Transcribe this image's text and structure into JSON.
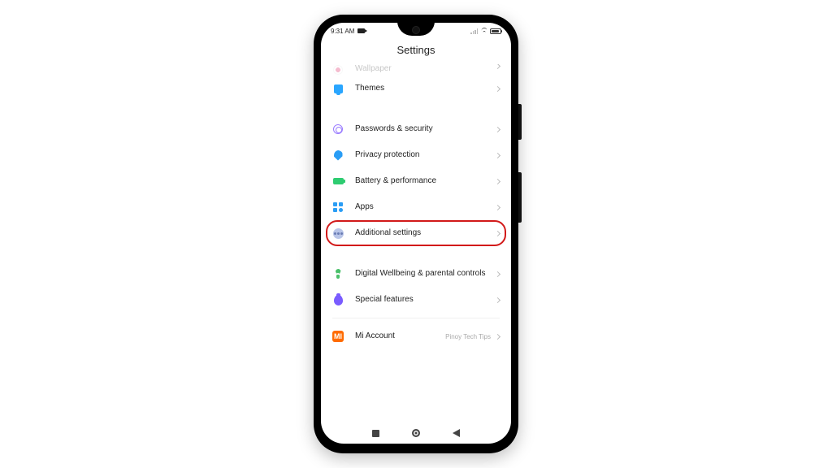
{
  "status": {
    "time": "9:31 AM"
  },
  "header": {
    "title": "Settings"
  },
  "rows": {
    "wallpaper": {
      "label": "Wallpaper"
    },
    "themes": {
      "label": "Themes"
    },
    "passwords": {
      "label": "Passwords & security"
    },
    "privacy": {
      "label": "Privacy protection"
    },
    "battery": {
      "label": "Battery & performance"
    },
    "apps": {
      "label": "Apps"
    },
    "additional": {
      "label": "Additional settings"
    },
    "wellbeing": {
      "label": "Digital Wellbeing & parental controls"
    },
    "special": {
      "label": "Special features"
    },
    "miaccount": {
      "label": "Mi Account",
      "sublabel": "Pinoy Tech Tips"
    }
  },
  "highlighted_row": "additional"
}
